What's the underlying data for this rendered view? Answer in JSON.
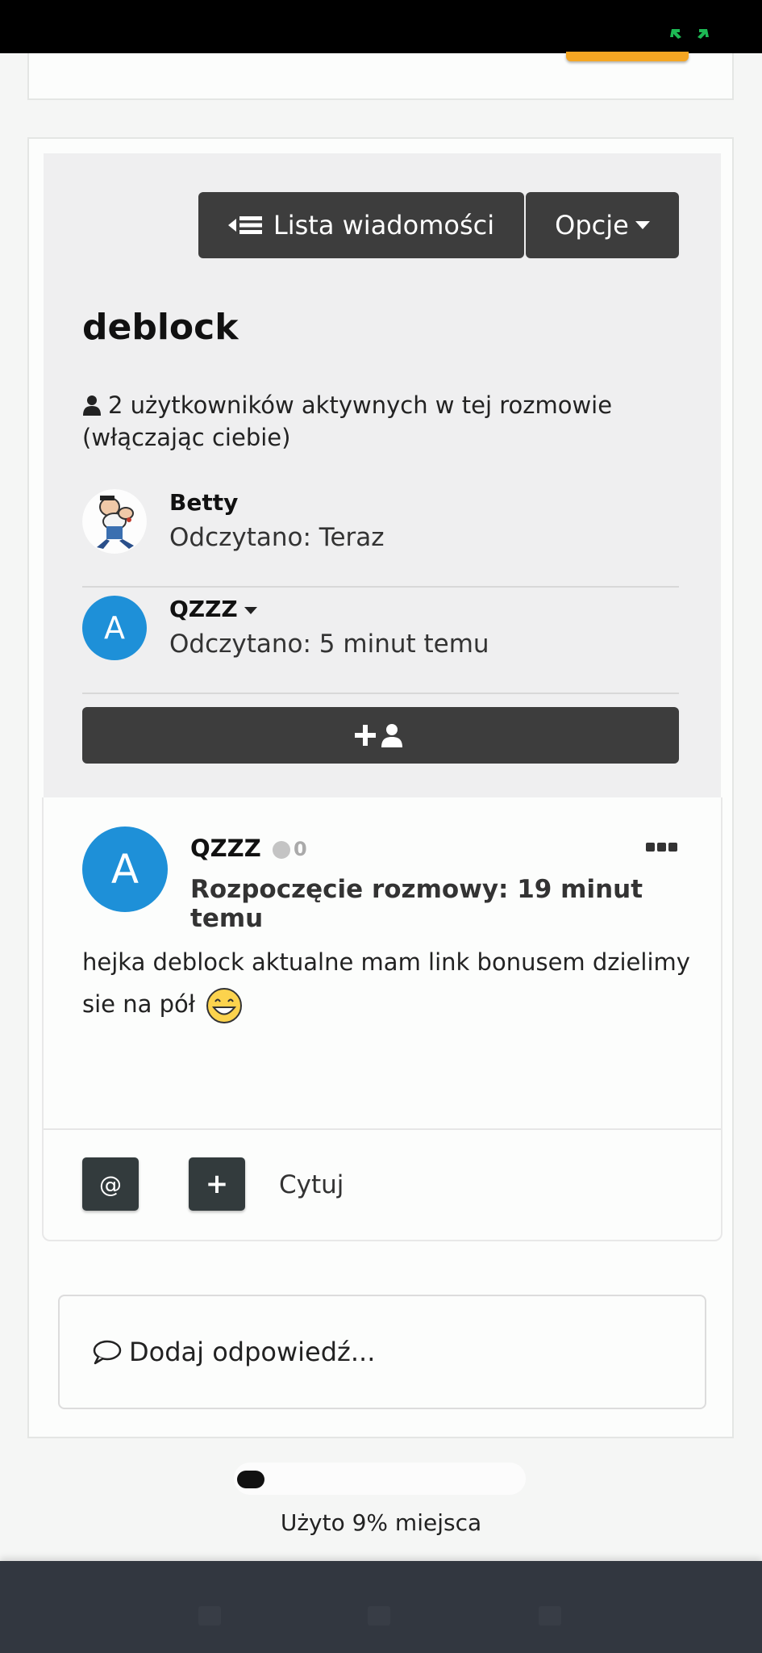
{
  "header": {
    "list_label": "Lista wiadomości",
    "options_label": "Opcje"
  },
  "conversation": {
    "title": "deblock",
    "active_users": "2 użytkowników aktywnych w tej rozmowie (włączając ciebie)",
    "participants": [
      {
        "name": "Betty",
        "read": "Odczytano: Teraz"
      },
      {
        "name": "QZZZ",
        "read": "Odczytano: 5 minut temu",
        "avatar_letter": "A"
      }
    ]
  },
  "post": {
    "author": "QZZZ",
    "avatar_letter": "A",
    "reputation": "0",
    "started": "Rozpoczęcie rozmowy: 19 minut temu",
    "body": "hejka deblock aktualne mam link bonusem dzielimy sie na pół",
    "mention_label": "@",
    "plus_label": "+",
    "quote_label": "Cytuj"
  },
  "reply": {
    "placeholder": "Dodaj odpowiedź..."
  },
  "storage": {
    "used_fraction": 0.09,
    "label": "Użyto 9% miejsca"
  },
  "colors": {
    "accent_blue": "#1e90d8",
    "dark_button": "#3d3d3d",
    "orange": "#f5a623"
  },
  "icons": {
    "list": "list-icon",
    "user": "user-icon",
    "add_user": "add-user-icon",
    "comment": "comment-icon",
    "emoji": "grin-emoji"
  }
}
